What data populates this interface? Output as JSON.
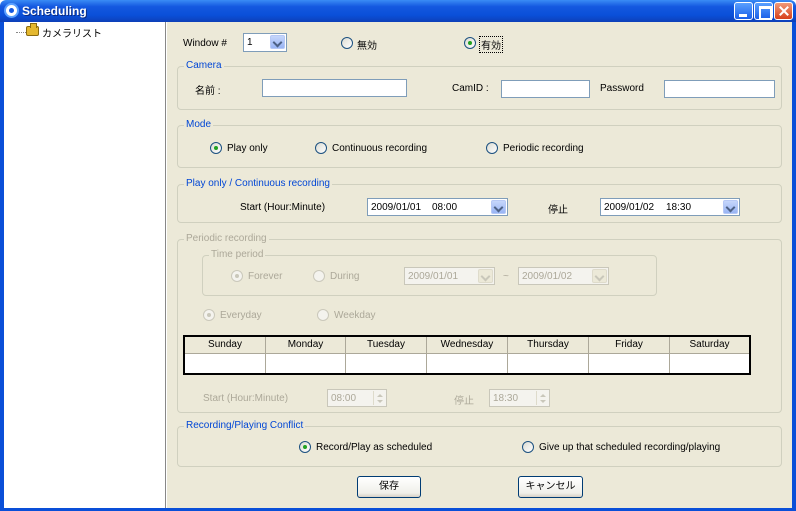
{
  "window": {
    "title": "Scheduling"
  },
  "tree": {
    "root_label": "カメラリスト"
  },
  "top": {
    "window_label": "Window #",
    "window_value": "1",
    "disabled_label": "無効",
    "enabled_label": "有効"
  },
  "camera": {
    "title": "Camera",
    "name_label": "名前 :",
    "name_value": "",
    "camid_label": "CamID :",
    "camid_value": "",
    "password_label": "Password",
    "password_value": ""
  },
  "mode": {
    "title": "Mode",
    "options": [
      "Play only",
      "Continuous recording",
      "Periodic recording"
    ],
    "selected": "Play only"
  },
  "play": {
    "title": "Play only / Continuous recording",
    "start_label": "Start (Hour:Minute)",
    "start_date": "2009/01/01",
    "start_time": "08:00",
    "stop_label": "停止",
    "stop_date": "2009/01/02",
    "stop_time": "18:30"
  },
  "periodic": {
    "title": "Periodic recording",
    "time_period_title": "Time period",
    "forever_label": "Forever",
    "during_label": "During",
    "during_from": "2009/01/01",
    "tilde": "~",
    "during_to": "2009/01/02",
    "everyday_label": "Everyday",
    "weekday_label": "Weekday",
    "days": [
      "Sunday",
      "Monday",
      "Tuesday",
      "Wednesday",
      "Thursday",
      "Friday",
      "Saturday"
    ],
    "start_label": "Start (Hour:Minute)",
    "start_value": "08:00",
    "stop_label": "停止",
    "stop_value": "18:30"
  },
  "conflict": {
    "title": "Recording/Playing Conflict",
    "option_scheduled": "Record/Play as scheduled",
    "option_give_up": "Give up that scheduled recording/playing"
  },
  "buttons": {
    "save": "保存",
    "cancel": "キャンセル"
  }
}
